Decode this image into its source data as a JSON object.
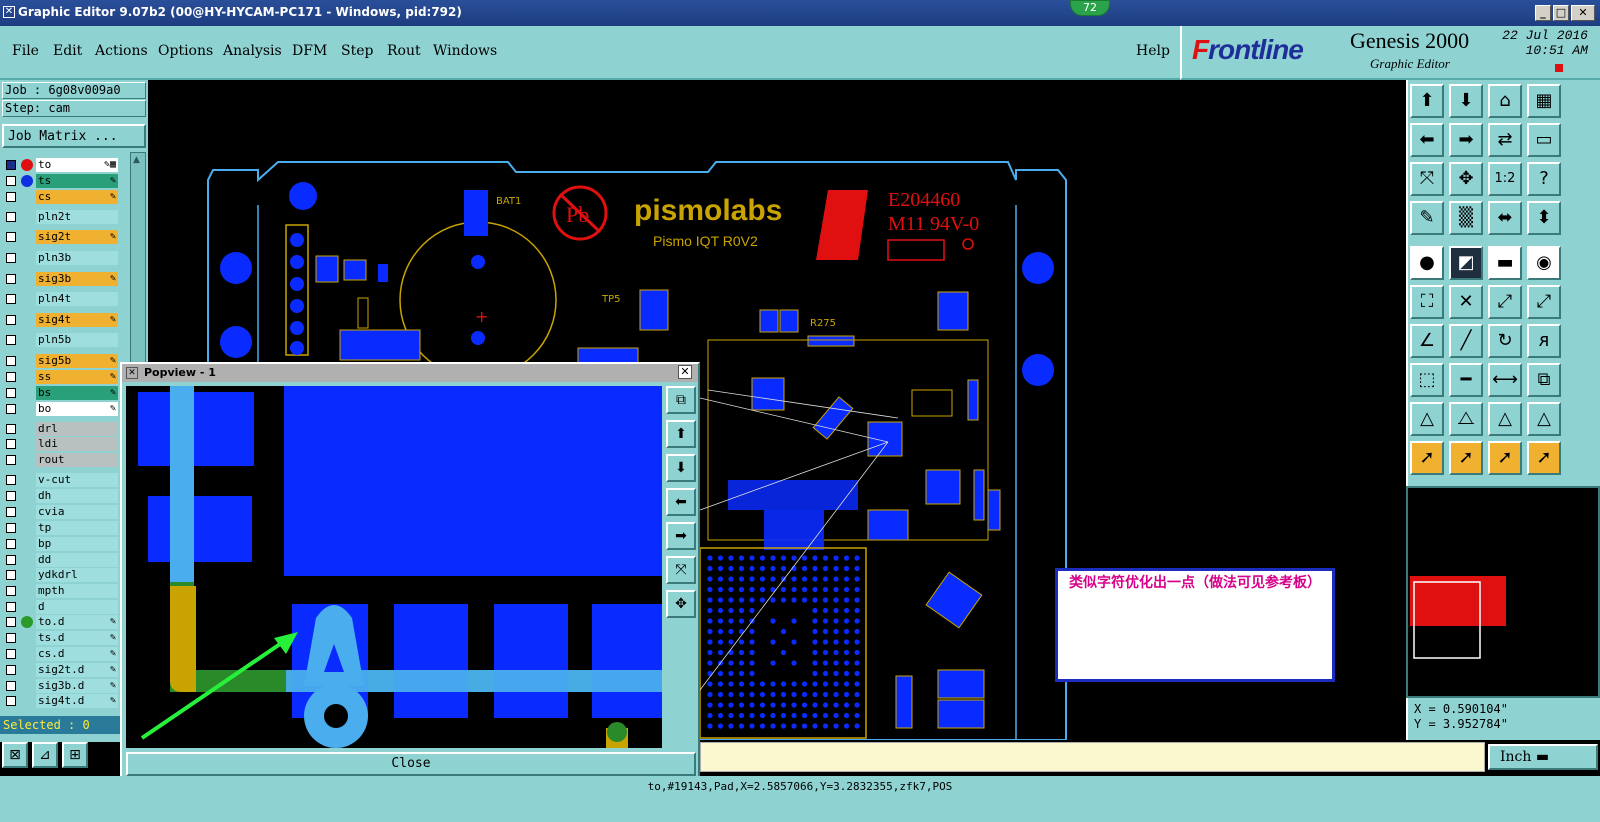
{
  "window": {
    "title": "Graphic Editor 9.07b2 (00@HY-HYCAM-PC171 - Windows, pid:792)",
    "badge": "72"
  },
  "menu": {
    "items": [
      "File",
      "Edit",
      "Actions",
      "Options",
      "Analysis",
      "DFM",
      "Step",
      "Rout",
      "Windows"
    ],
    "help": "Help"
  },
  "brand": {
    "logo": "Frontline",
    "product": "Genesis 2000",
    "subtitle": "Graphic Editor",
    "date": "22 Jul 2016",
    "time": "10:51 AM"
  },
  "job": {
    "job_label": "Job : 6g08v009a0",
    "step_label": "Step: cam",
    "matrix_button": "Job Matrix ..."
  },
  "layers": [
    {
      "name": "to",
      "dot": "#e01010",
      "bg": "#ffffff",
      "checked": true,
      "tag": "✎▦"
    },
    {
      "name": "ts",
      "dot": "#1030e0",
      "bg": "#2aa07a",
      "checked": false,
      "tag": "✎"
    },
    {
      "name": "cs",
      "dot": "",
      "bg": "#f0b030",
      "checked": false,
      "tag": "✎"
    },
    {
      "name": "pln2t",
      "dot": "",
      "bg": "#9fdede",
      "checked": false,
      "tag": ""
    },
    {
      "name": "sig2t",
      "dot": "",
      "bg": "#f0b030",
      "checked": false,
      "tag": "✎"
    },
    {
      "name": "pln3b",
      "dot": "",
      "bg": "#9fdede",
      "checked": false,
      "tag": ""
    },
    {
      "name": "sig3b",
      "dot": "",
      "bg": "#f0b030",
      "checked": false,
      "tag": "✎"
    },
    {
      "name": "pln4t",
      "dot": "",
      "bg": "#9fdede",
      "checked": false,
      "tag": ""
    },
    {
      "name": "sig4t",
      "dot": "",
      "bg": "#f0b030",
      "checked": false,
      "tag": "✎"
    },
    {
      "name": "pln5b",
      "dot": "",
      "bg": "#9fdede",
      "checked": false,
      "tag": ""
    },
    {
      "name": "sig5b",
      "dot": "",
      "bg": "#f0b030",
      "checked": false,
      "tag": "✎"
    },
    {
      "name": "ss",
      "dot": "",
      "bg": "#f0b030",
      "checked": false,
      "tag": "✎"
    },
    {
      "name": "bs",
      "dot": "",
      "bg": "#2aa07a",
      "checked": false,
      "tag": "✎"
    },
    {
      "name": "bo",
      "dot": "",
      "bg": "#ffffff",
      "checked": false,
      "tag": "✎"
    },
    {
      "name": "drl",
      "dot": "",
      "bg": "#b8c0c0",
      "checked": false,
      "tag": ""
    },
    {
      "name": "ldi",
      "dot": "",
      "bg": "#b8c0c0",
      "checked": false,
      "tag": ""
    },
    {
      "name": "rout",
      "dot": "",
      "bg": "#b8c0c0",
      "checked": false,
      "tag": ""
    },
    {
      "name": "v-cut",
      "dot": "",
      "bg": "#9fdede",
      "checked": false,
      "tag": ""
    },
    {
      "name": "dh",
      "dot": "",
      "bg": "#9fdede",
      "checked": false,
      "tag": ""
    },
    {
      "name": "cvia",
      "dot": "",
      "bg": "#9fdede",
      "checked": false,
      "tag": ""
    },
    {
      "name": "tp",
      "dot": "",
      "bg": "#9fdede",
      "checked": false,
      "tag": ""
    },
    {
      "name": "bp",
      "dot": "",
      "bg": "#9fdede",
      "checked": false,
      "tag": ""
    },
    {
      "name": "dd",
      "dot": "",
      "bg": "#9fdede",
      "checked": false,
      "tag": ""
    },
    {
      "name": "ydkdrl",
      "dot": "",
      "bg": "#9fdede",
      "checked": false,
      "tag": ""
    },
    {
      "name": "mpth",
      "dot": "",
      "bg": "#9fdede",
      "checked": false,
      "tag": ""
    },
    {
      "name": "d",
      "dot": "",
      "bg": "#9fdede",
      "checked": false,
      "tag": ""
    },
    {
      "name": "to.d",
      "dot": "#2a9a2a",
      "bg": "#9fdede",
      "checked": false,
      "tag": "✎"
    },
    {
      "name": "ts.d",
      "dot": "",
      "bg": "#9fdede",
      "checked": false,
      "tag": "✎"
    },
    {
      "name": "cs.d",
      "dot": "",
      "bg": "#9fdede",
      "checked": false,
      "tag": "✎"
    },
    {
      "name": "sig2t.d",
      "dot": "",
      "bg": "#9fdede",
      "checked": false,
      "tag": "✎"
    },
    {
      "name": "sig3b.d",
      "dot": "",
      "bg": "#9fdede",
      "checked": false,
      "tag": "✎"
    },
    {
      "name": "sig4t.d",
      "dot": "",
      "bg": "#9fdede",
      "checked": false,
      "tag": "✎"
    }
  ],
  "selected_label": "Selected : 0",
  "xy_label": "X Y",
  "popview": {
    "title": "Popview - 1",
    "close_label": "Close"
  },
  "pcb_text": {
    "vendor": "pismolabs",
    "board": "Pismo IQT R0V2",
    "ul1": "E204460",
    "ul2": "M11 94V-0",
    "bat": "BAT1",
    "r275": "R275",
    "tp5": "TP5",
    "pb": "Pb"
  },
  "note_text": "类似字符优化出一点（做法可见参考板）",
  "coords": {
    "x": "X = 0.590104\"",
    "y": "Y = 3.952784\""
  },
  "units_button": "Inch",
  "status_text": "to,#19143,Pad,X=2.5857066,Y=3.2832355,zfk7,POS",
  "colors": {
    "panel": "#8fd2d2",
    "pad_blue": "#0a2bff",
    "trace_yellow": "#c9a400",
    "silk_light": "#4aaeee",
    "alert_red": "#e01010"
  }
}
